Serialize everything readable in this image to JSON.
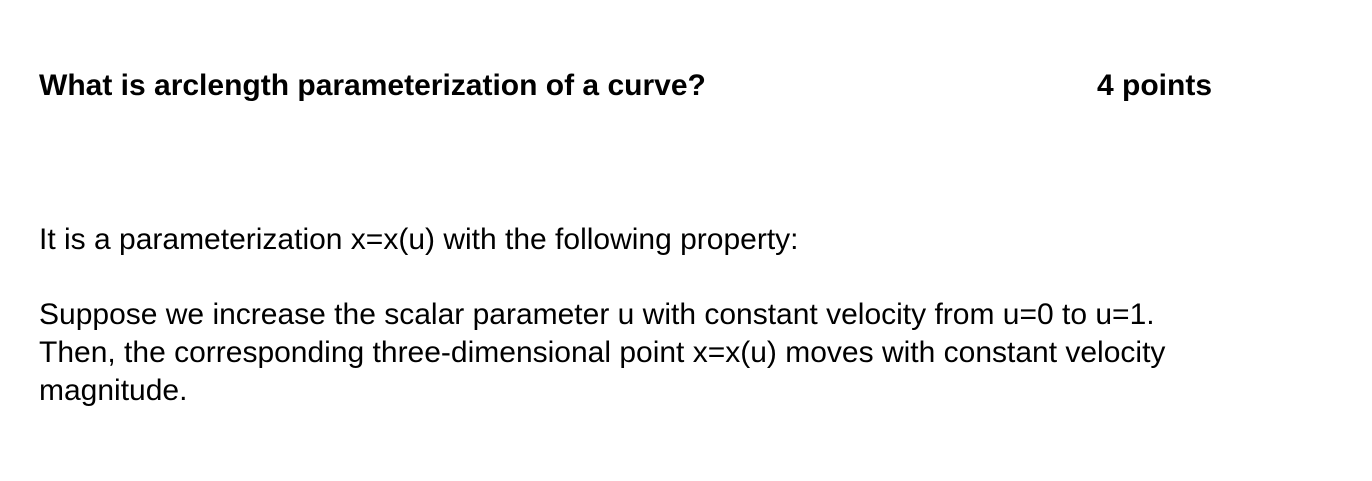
{
  "question": {
    "title": "What is arclength parameterization of a curve?",
    "points": "4 points"
  },
  "answer": {
    "intro": "It is a parameterization x=x(u) with the following property:",
    "lines": [
      "Suppose we increase the scalar parameter u with constant velocity from u=0 to u=1.",
      "Then, the corresponding three-dimensional point x=x(u) moves with constant velocity",
      "magnitude."
    ]
  }
}
